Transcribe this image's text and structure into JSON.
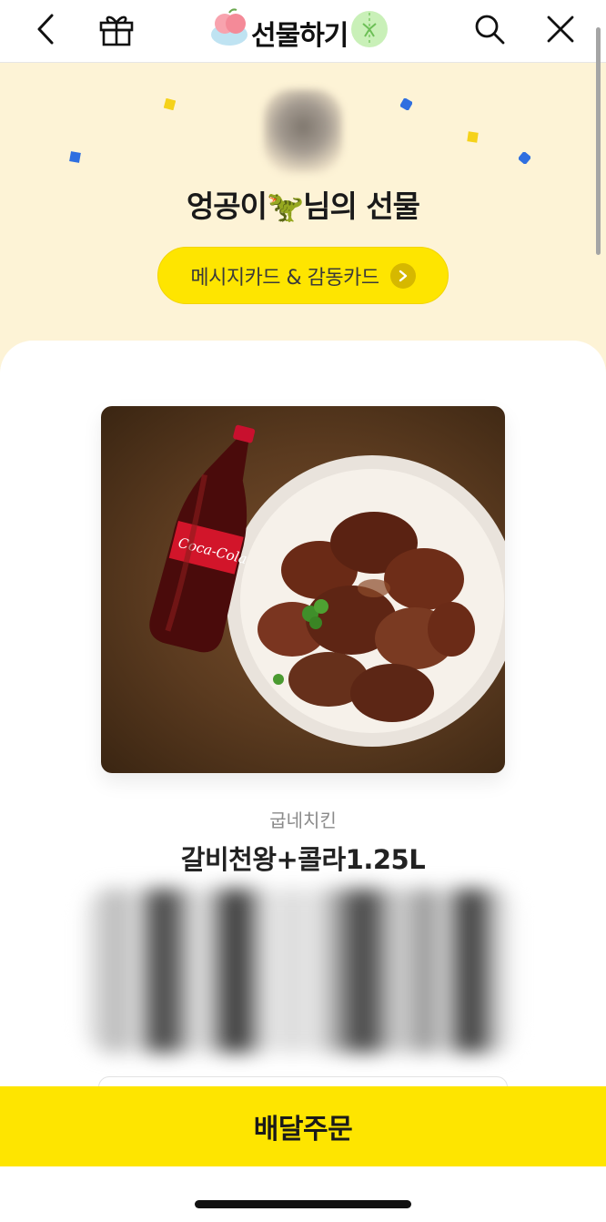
{
  "header": {
    "title": "선물하기",
    "back_icon": "chevron-left-icon",
    "gift_icon": "gift-box-icon",
    "search_icon": "search-icon",
    "close_icon": "close-icon"
  },
  "hero": {
    "sender_name": "엉공이🦖님의 선물",
    "message_button_label": "메시지카드 & 감동카드",
    "background_color": "#fdf3d6"
  },
  "product": {
    "brand": "굽네치킨",
    "name": "갈비천왕+콜라1.25L",
    "bottle_label": "Coca-Cola"
  },
  "footer": {
    "order_button_label": "배달주문",
    "accent_color": "#fee500"
  }
}
